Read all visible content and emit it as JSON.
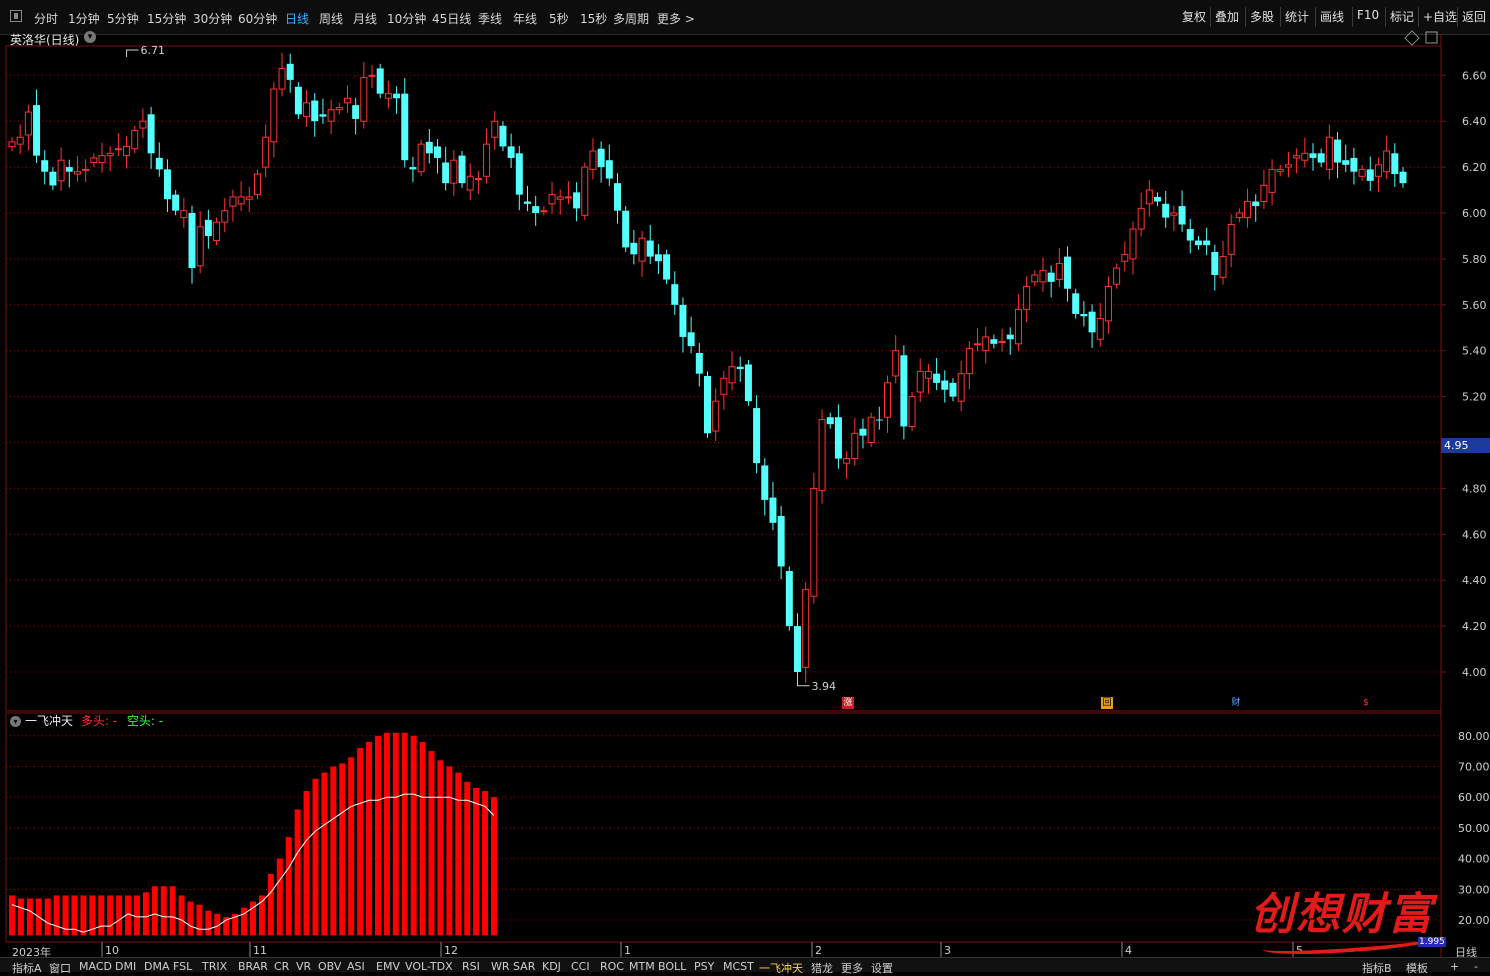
{
  "toolbar": {
    "periods": [
      {
        "label": "分时",
        "active": false
      },
      {
        "label": "1分钟",
        "active": false
      },
      {
        "label": "5分钟",
        "active": false
      },
      {
        "label": "15分钟",
        "active": false
      },
      {
        "label": "30分钟",
        "active": false
      },
      {
        "label": "60分钟",
        "active": false
      },
      {
        "label": "日线",
        "active": true
      },
      {
        "label": "周线",
        "active": false
      },
      {
        "label": "月线",
        "active": false
      },
      {
        "label": "10分钟",
        "active": false
      },
      {
        "label": "45日线",
        "active": false
      },
      {
        "label": "季线",
        "active": false
      },
      {
        "label": "年线",
        "active": false
      },
      {
        "label": "5秒",
        "active": false
      },
      {
        "label": "15秒",
        "active": false
      },
      {
        "label": "多周期",
        "active": false
      },
      {
        "label": "更多 >",
        "active": false
      }
    ],
    "right_buttons": [
      "复权",
      "叠加",
      "多股",
      "统计",
      "画线",
      "F10",
      "标记",
      "+自选",
      "返回"
    ]
  },
  "chart_header": {
    "stock_title": "英洛华(日线)",
    "current_price": "4.95",
    "high_marker": "6.71",
    "low_marker": "3.94"
  },
  "event_markers": [
    "涨",
    "回",
    "财",
    "$"
  ],
  "sub_chart": {
    "title": "一飞冲天",
    "bull_label": "多头: -",
    "bear_label": "空头: -"
  },
  "time_axis": [
    "2023年",
    "10",
    "11",
    "12",
    "1",
    "2",
    "3",
    "4",
    "5"
  ],
  "bottom_tabs": [
    "指标A",
    "窗口",
    "MACD",
    "DMI",
    "DMA",
    "FSL",
    "TRIX",
    "BRAR",
    "CR",
    "VR",
    "OBV",
    "ASI",
    "EMV",
    "VOL-TDX",
    "RSI",
    "WR",
    "SAR",
    "KDJ",
    "CCI",
    "ROC",
    "MTM",
    "BOLL",
    "PSY",
    "MCST",
    "一飞冲天",
    "猎龙",
    "更多",
    "设置"
  ],
  "bottom_right_tabs": [
    "指标B",
    "模板",
    "+",
    "-"
  ],
  "right_period_label": "日线",
  "watermark": "创想财富",
  "watermark_small": "1.995",
  "colors": {
    "up": "#ff3333",
    "down": "#54ffff",
    "grid": "#7a1010",
    "bull": "#ff0000",
    "bear": "#00ff00"
  },
  "chart_data": [
    {
      "type": "candlestick",
      "title": "英洛华(日线)",
      "ylim": [
        3.9,
        6.75
      ],
      "yticks": [
        4.0,
        4.2,
        4.4,
        4.6,
        4.8,
        5.0,
        5.2,
        5.4,
        5.6,
        5.8,
        6.0,
        6.2,
        6.4,
        6.6
      ],
      "closes": [
        6.31,
        6.33,
        6.44,
        6.25,
        6.18,
        6.12,
        6.23,
        6.18,
        6.18,
        6.19,
        6.24,
        6.25,
        6.26,
        6.28,
        6.29,
        6.36,
        6.4,
        6.26,
        6.19,
        6.06,
        6.01,
        6.01,
        5.76,
        5.94,
        5.9,
        5.96,
        6.01,
        6.07,
        6.07,
        6.07,
        6.17,
        6.33,
        6.54,
        6.63,
        6.58,
        6.43,
        6.48,
        6.4,
        6.42,
        6.45,
        6.46,
        6.5,
        6.41,
        6.59,
        6.6,
        6.52,
        6.52,
        6.5,
        6.23,
        6.19,
        6.3,
        6.26,
        6.24,
        6.13,
        6.23,
        6.13,
        6.16,
        6.15,
        6.3,
        6.4,
        6.29,
        6.24,
        6.08,
        6.04,
        6.0,
        6.01,
        6.08,
        6.07,
        6.07,
        6.02,
        6.2,
        6.27,
        6.2,
        6.15,
        6.01,
        5.85,
        5.82,
        5.89,
        5.81,
        5.79,
        5.71,
        5.6,
        5.46,
        5.42,
        5.3,
        5.04,
        5.18,
        5.28,
        5.33,
        5.32,
        5.18,
        4.91,
        4.75,
        4.65,
        4.46,
        4.2,
        4.0,
        4.36,
        4.8,
        5.1,
        5.08,
        4.93,
        4.93,
        5.04,
        5.03,
        5.11,
        5.1,
        5.26,
        5.4,
        5.07,
        5.2,
        5.31,
        5.31,
        5.26,
        5.23,
        5.2,
        5.3,
        5.41,
        5.43,
        5.46,
        5.43,
        5.44,
        5.45,
        5.58,
        5.68,
        5.73,
        5.75,
        5.7,
        5.78,
        5.67,
        5.56,
        5.55,
        5.48,
        5.54,
        5.68,
        5.76,
        5.82,
        5.93,
        6.02,
        6.1,
        6.05,
        5.98,
        6.0,
        5.95,
        5.88,
        5.86,
        5.86,
        5.73,
        5.81,
        5.95,
        6.0,
        6.05,
        6.03,
        6.12,
        6.19,
        6.19,
        6.21,
        6.25,
        6.26,
        6.24,
        6.22,
        6.33,
        6.22,
        6.21,
        6.18,
        6.19,
        6.14,
        6.21,
        6.27,
        6.17,
        6.13
      ]
    },
    {
      "type": "bar",
      "title": "一飞冲天",
      "ylim": [
        15,
        85
      ],
      "yticks": [
        20,
        30,
        40,
        50,
        60,
        70,
        80
      ],
      "bull_values": [
        28,
        27,
        27,
        27,
        27,
        28,
        28,
        28,
        28,
        28,
        28,
        28,
        28,
        28,
        28,
        29,
        31,
        31,
        31,
        28,
        26,
        25,
        23,
        22,
        21,
        22,
        24,
        26,
        28,
        35,
        40,
        47,
        56,
        62,
        66,
        68,
        70,
        71,
        73,
        76,
        78,
        80,
        81,
        81,
        81,
        80,
        78,
        75,
        72,
        70,
        68,
        65,
        63,
        62,
        60
      ],
      "bear_values": [
        25,
        24,
        23,
        21,
        19,
        18,
        17,
        17,
        16,
        17,
        18,
        18,
        20,
        22,
        21,
        21,
        22,
        21,
        21,
        20,
        18,
        17,
        17,
        18,
        20,
        21,
        22,
        24,
        26,
        29,
        33,
        37,
        42,
        46,
        49,
        51,
        53,
        55,
        57,
        58,
        59,
        59,
        60,
        60,
        61,
        61,
        60,
        60,
        60,
        60,
        59,
        59,
        58,
        57,
        54
      ]
    }
  ]
}
